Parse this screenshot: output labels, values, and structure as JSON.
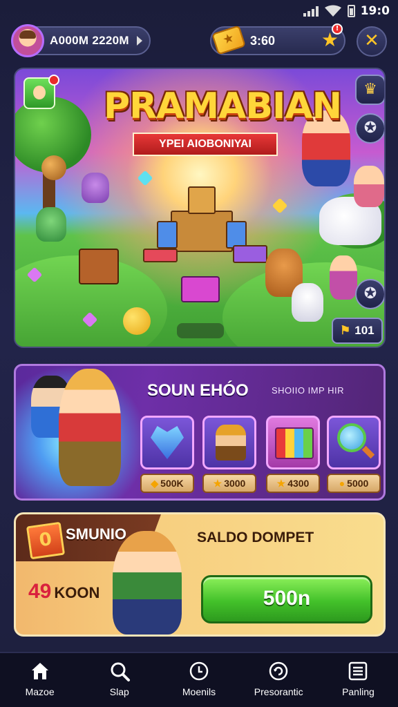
{
  "status_bar": {
    "time": "19:0"
  },
  "top_bar": {
    "profile_name": "A000M 2220M",
    "currency_value": "3:60",
    "notification_count": "!",
    "close_icon": "close-icon"
  },
  "hero": {
    "title": "PRAMABIAN",
    "ribbon": "YPEI AIOBONIYAI",
    "level_value": "101"
  },
  "shop": {
    "title": "SOUN EHÓO",
    "subtitle": "SHOIIO IMP HIR",
    "items": [
      {
        "name": "heart",
        "price": "500K",
        "icon": "gem-icon"
      },
      {
        "name": "explorer",
        "price": "3000",
        "icon": "star-icon"
      },
      {
        "name": "chest",
        "price": "4300",
        "icon": "star-icon"
      },
      {
        "name": "magnifier",
        "price": "5000",
        "icon": "coin-icon"
      }
    ]
  },
  "offer": {
    "name": "SMUNIO",
    "title": "SALDO DOMPET",
    "count_number": "49",
    "count_label": "KOON",
    "button_label": "500n"
  },
  "nav": [
    {
      "label": "Mazoe",
      "icon": "home-icon"
    },
    {
      "label": "Slap",
      "icon": "search-icon"
    },
    {
      "label": "Moenils",
      "icon": "clock-icon"
    },
    {
      "label": "Presorantic",
      "icon": "refresh-icon"
    },
    {
      "label": "Panling",
      "icon": "menu-icon"
    }
  ],
  "colors": {
    "background": "#1b1d3a",
    "accent_gold": "#ffc526",
    "buy_green": "#43c12a",
    "shop_purple": "#6e2fa8",
    "offer_orange": "#f7cf80"
  }
}
